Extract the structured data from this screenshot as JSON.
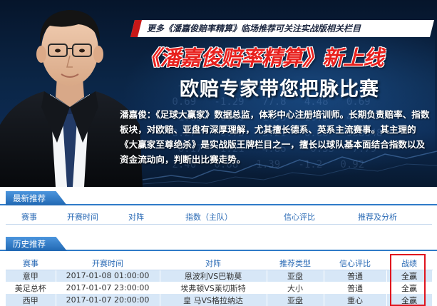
{
  "banner": {
    "strip_text": "更多《潘嘉俊赔率精算》临场推荐可关注实战版相关栏目",
    "headline": "《潘嘉俊赔率精算》新上线",
    "subheadline": "欧赔专家带您把脉比赛",
    "bio": "潘嘉俊：《足球大赢家》数据总监，体彩中心注册培训师。长期负责赔率、指数板块，对欧赔、亚盘有深厚理解，尤其擅长德系、英系主流赛事。其主理的《大赢家至尊绝杀》是实战版王牌栏目之一，擅长以球队基本面结合指数以及资金流动向，判断出比赛走势。",
    "colors": {
      "headline": "#e8201d",
      "strip_accent": "#c81818",
      "background": "#0b2647"
    }
  },
  "latest": {
    "title": "最新推荐",
    "columns": [
      "赛事",
      "开赛时间",
      "对阵",
      "指数（主队）",
      "信心评比",
      "推荐及分析"
    ]
  },
  "history": {
    "title": "历史推荐",
    "columns": [
      "赛事",
      "开赛时间",
      "对阵",
      "推荐类型",
      "信心评比",
      "战绩"
    ],
    "rows": [
      {
        "league": "意甲",
        "time": "2017-01-08 01:00:00",
        "match": "恩波利VS巴勒莫",
        "type": "亚盘",
        "confidence": "普通",
        "result": "全赢"
      },
      {
        "league": "美足总杯",
        "time": "2017-01-07 23:00:00",
        "match": "埃弗顿VS莱切斯特",
        "type": "大小",
        "confidence": "普通",
        "result": "全赢"
      },
      {
        "league": "西甲",
        "time": "2017-01-07 20:00:00",
        "match": "皇 马VS格拉纳达",
        "type": "亚盘",
        "confidence": "重心",
        "result": "全赢"
      }
    ],
    "colors": {
      "header_text": "#2a6ab5",
      "row_alt": "#d7e7f7",
      "highlight_box": "#e0141e"
    }
  }
}
